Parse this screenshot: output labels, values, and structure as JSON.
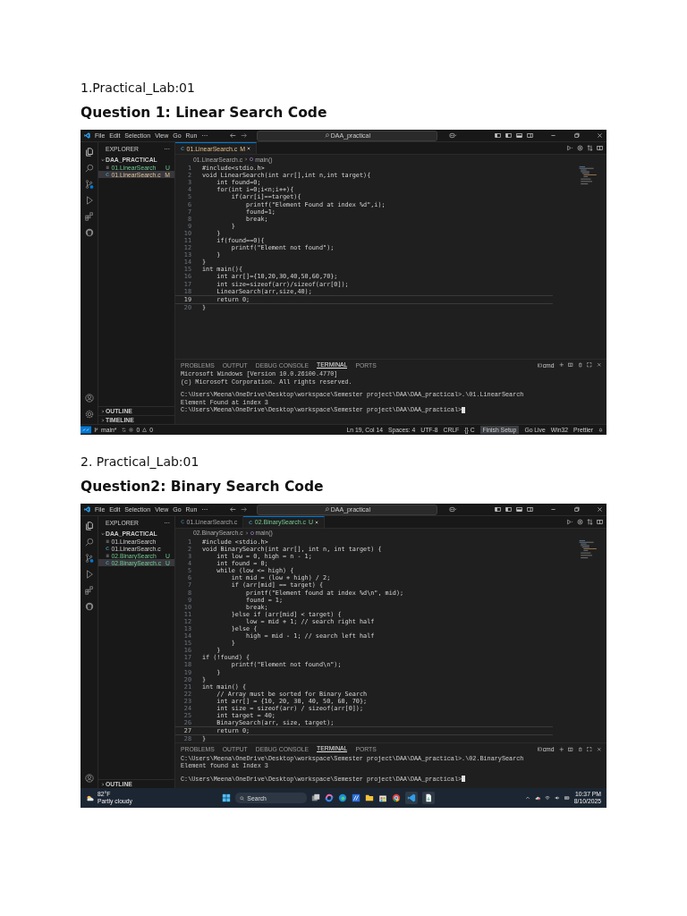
{
  "sections": [
    {
      "label": "1.Practical_Lab:01",
      "heading": "Question 1: Linear Search Code",
      "window": {
        "menus": [
          "File",
          "Edit",
          "Selection",
          "View",
          "Go",
          "Run",
          "···"
        ],
        "search": "DAA_practical",
        "explorer": {
          "title": "EXPLORER",
          "more": "···",
          "folder": "DAA_PRACTICAL",
          "files": [
            {
              "name": "01.LinearSearch",
              "kind": "exe",
              "badge": "U",
              "untracked": true,
              "modified": false,
              "selected": false
            },
            {
              "name": "01.LinearSearch.c",
              "kind": "c",
              "badge": "M",
              "untracked": false,
              "modified": true,
              "selected": true
            }
          ],
          "sections": [
            "OUTLINE",
            "TIMELINE"
          ]
        },
        "tabs": [
          {
            "name": "01.LinearSearch.c",
            "badge": "M",
            "untracked": false,
            "modified": true,
            "selected": true
          }
        ],
        "breadcrumb": {
          "file": "01.LinearSearch.c",
          "symbol": "main()"
        },
        "lines": [
          {
            "n": "1",
            "text": "#include<stdio.h>",
            "current": false
          },
          {
            "n": "2",
            "text": "void LinearSearch(int arr[],int n,int target){",
            "current": false
          },
          {
            "n": "3",
            "text": "    int found=0;",
            "current": false
          },
          {
            "n": "4",
            "text": "    for(int i=0;i<n;i++){",
            "current": false
          },
          {
            "n": "5",
            "text": "        if(arr[i]==target){",
            "current": false
          },
          {
            "n": "6",
            "text": "            printf(\"Element Found at index %d\",i);",
            "current": false
          },
          {
            "n": "7",
            "text": "            found=1;",
            "current": false
          },
          {
            "n": "8",
            "text": "            break;",
            "current": false
          },
          {
            "n": "9",
            "text": "        }",
            "current": false
          },
          {
            "n": "10",
            "text": "    }",
            "current": false
          },
          {
            "n": "11",
            "text": "    if(found==0){",
            "current": false
          },
          {
            "n": "12",
            "text": "        printf(\"Element not found\");",
            "current": false
          },
          {
            "n": "13",
            "text": "    }",
            "current": false
          },
          {
            "n": "14",
            "text": "}",
            "current": false
          },
          {
            "n": "15",
            "text": "int main(){",
            "current": false
          },
          {
            "n": "16",
            "text": "    int arr[]={10,20,30,40,50,60,70};",
            "current": false
          },
          {
            "n": "17",
            "text": "    int size=sizeof(arr)/sizeof(arr[0]);",
            "current": false
          },
          {
            "n": "18",
            "text": "    LinearSearch(arr,size,40);",
            "current": false
          },
          {
            "n": "19",
            "text": "    return 0;",
            "current": true
          },
          {
            "n": "20",
            "text": "}",
            "current": false
          }
        ],
        "panel_tabs": [
          {
            "label": "PROBLEMS",
            "selected": false
          },
          {
            "label": "OUTPUT",
            "selected": false
          },
          {
            "label": "DEBUG CONSOLE",
            "selected": false
          },
          {
            "label": "TERMINAL",
            "selected": true
          },
          {
            "label": "PORTS",
            "selected": false
          }
        ],
        "shell": "cmd",
        "terminal": [
          {
            "text": "Microsoft Windows [Version 10.0.26100.4770]",
            "gap_before": false,
            "cursor": false
          },
          {
            "text": "(c) Microsoft Corporation. All rights reserved.",
            "gap_before": false,
            "cursor": false
          },
          {
            "text": "C:\\Users\\Meena\\OneDrive\\Desktop\\workspace\\Semester project\\DAA\\DAA_practical>.\\01.LinearSearch",
            "gap_before": true,
            "cursor": false
          },
          {
            "text": "Element Found at index 3",
            "gap_before": false,
            "cursor": false
          },
          {
            "text": "C:\\Users\\Meena\\OneDrive\\Desktop\\workspace\\Semester project\\DAA\\DAA_practical>",
            "gap_before": false,
            "cursor": true
          }
        ],
        "bottom": {
          "kind": "status_bar",
          "branch": "main*",
          "errors": "0",
          "warnings": "0",
          "items": [
            {
              "text": "Ln 19, Col 14",
              "kind": "text"
            },
            {
              "text": "Spaces: 4",
              "kind": "text"
            },
            {
              "text": "UTF-8",
              "kind": "text"
            },
            {
              "text": "CRLF",
              "kind": "text"
            },
            {
              "text": "{} C",
              "kind": "text"
            },
            {
              "text": "Finish Setup",
              "kind": "button"
            },
            {
              "text": "Go Live",
              "kind": "broadcast"
            },
            {
              "text": "Win32",
              "kind": "text"
            },
            {
              "text": "Prettier",
              "kind": "check"
            }
          ]
        }
      }
    },
    {
      "label": "2. Practical_Lab:01",
      "heading": "Question2: Binary Search Code",
      "window": {
        "menus": [
          "File",
          "Edit",
          "Selection",
          "View",
          "Go",
          "Run",
          "···"
        ],
        "search": "DAA_practical",
        "explorer": {
          "title": "EXPLORER",
          "more": "···",
          "folder": "DAA_PRACTICAL",
          "files": [
            {
              "name": "01.LinearSearch",
              "kind": "exe",
              "untracked": false,
              "modified": false,
              "selected": false
            },
            {
              "name": "01.LinearSearch.c",
              "kind": "c",
              "untracked": false,
              "modified": false,
              "selected": false
            },
            {
              "name": "02.BinarySearch",
              "kind": "exe",
              "badge": "U",
              "untracked": true,
              "modified": false,
              "selected": false
            },
            {
              "name": "02.BinarySearch.c",
              "kind": "c",
              "badge": "U",
              "untracked": true,
              "modified": false,
              "selected": true
            }
          ],
          "sections": [
            "OUTLINE"
          ]
        },
        "tabs": [
          {
            "name": "01.LinearSearch.c",
            "untracked": false,
            "modified": false,
            "selected": false
          },
          {
            "name": "02.BinarySearch.c",
            "badge": "U",
            "untracked": true,
            "modified": false,
            "selected": true
          }
        ],
        "breadcrumb": {
          "file": "02.BinarySearch.c",
          "symbol": "main()"
        },
        "lines": [
          {
            "n": "1",
            "text": "#include <stdio.h>",
            "current": false
          },
          {
            "n": "2",
            "text": "void BinarySearch(int arr[], int n, int target) {",
            "current": false
          },
          {
            "n": "3",
            "text": "    int low = 0, high = n - 1;",
            "current": false
          },
          {
            "n": "4",
            "text": "    int found = 0;",
            "current": false
          },
          {
            "n": "5",
            "text": "    while (low <= high) {",
            "current": false
          },
          {
            "n": "6",
            "text": "        int mid = (low + high) / 2;",
            "current": false
          },
          {
            "n": "7",
            "text": "        if (arr[mid] == target) {",
            "current": false
          },
          {
            "n": "8",
            "text": "            printf(\"Element found at index %d\\n\", mid);",
            "current": false
          },
          {
            "n": "9",
            "text": "            found = 1;",
            "current": false
          },
          {
            "n": "10",
            "text": "            break;",
            "current": false
          },
          {
            "n": "11",
            "text": "        }else if (arr[mid] < target) {",
            "current": false
          },
          {
            "n": "12",
            "text": "            low = mid + 1; // search right half",
            "current": false
          },
          {
            "n": "13",
            "text": "        }else {",
            "current": false
          },
          {
            "n": "14",
            "text": "            high = mid - 1; // search left half",
            "current": false
          },
          {
            "n": "15",
            "text": "        }",
            "current": false
          },
          {
            "n": "16",
            "text": "    }",
            "current": false
          },
          {
            "n": "17",
            "text": "if (!found) {",
            "current": false
          },
          {
            "n": "18",
            "text": "        printf(\"Element not found\\n\");",
            "current": false
          },
          {
            "n": "19",
            "text": "    }",
            "current": false
          },
          {
            "n": "20",
            "text": "}",
            "current": false
          },
          {
            "n": "21",
            "text": "int main() {",
            "current": false
          },
          {
            "n": "22",
            "text": "    // Array must be sorted for Binary Search",
            "current": false
          },
          {
            "n": "23",
            "text": "    int arr[] = {10, 20, 30, 40, 50, 60, 70};",
            "current": false
          },
          {
            "n": "24",
            "text": "    int size = sizeof(arr) / sizeof(arr[0]);",
            "current": false
          },
          {
            "n": "25",
            "text": "    int target = 40;",
            "current": false
          },
          {
            "n": "26",
            "text": "    BinarySearch(arr, size, target);",
            "current": false
          },
          {
            "n": "27",
            "text": "    return 0;",
            "current": true
          },
          {
            "n": "28",
            "text": "}",
            "current": false
          }
        ],
        "panel_tabs": [
          {
            "label": "PROBLEMS",
            "selected": false
          },
          {
            "label": "OUTPUT",
            "selected": false
          },
          {
            "label": "DEBUG CONSOLE",
            "selected": false
          },
          {
            "label": "TERMINAL",
            "selected": true
          },
          {
            "label": "PORTS",
            "selected": false
          }
        ],
        "shell": "cmd",
        "terminal": [
          {
            "text": "C:\\Users\\Meena\\OneDrive\\Desktop\\workspace\\Semester project\\DAA\\DAA_practical>.\\02.BinarySearch",
            "gap_before": false,
            "cursor": false
          },
          {
            "text": "Element found at Index 3",
            "gap_before": false,
            "cursor": false
          },
          {
            "text": "C:\\Users\\Meena\\OneDrive\\Desktop\\workspace\\Semester project\\DAA\\DAA_practical>",
            "gap_before": true,
            "cursor": true
          }
        ],
        "bottom": {
          "kind": "taskbar",
          "temperature": "82°F",
          "weather": "Partly cloudy",
          "search": "Search",
          "time": "10:37 PM",
          "date": "8/10/2025"
        }
      }
    }
  ]
}
